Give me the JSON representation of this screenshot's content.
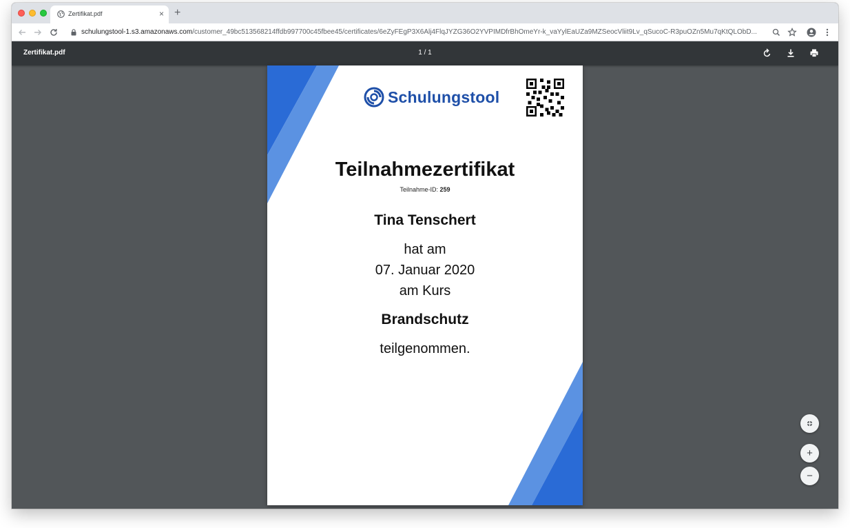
{
  "browser": {
    "tab_title": "Zertifikat.pdf",
    "tab_close": "×",
    "new_tab": "+",
    "url_host": "schulungstool-1.s3.amazonaws.com",
    "url_path": "/customer_49bc513568214ffdb997700c45fbee45/certificates/6eZyFEgP3X6Alj4FlqJYZG36O2YVPIMDfrBhOmeYr-k_vaYylEaUZa9MZSeocVliit9Lv_qSucoC-R3puOZn5Mu7qKtQLObD..."
  },
  "pdf_toolbar": {
    "title": "Zertifikat.pdf",
    "page_indicator": "1 / 1"
  },
  "certificate": {
    "logo_text": "Schulungstool",
    "title": "Teilnahmezertifikat",
    "id_label": "Teilnahme-ID:",
    "id_value": "259",
    "name": "Tina Tenschert",
    "line1": "hat am",
    "date": "07. Januar 2020",
    "line3": "am Kurs",
    "course": "Brandschutz",
    "ending": "teilgenommen."
  },
  "zoom": {
    "fit": "⤡",
    "plus": "+",
    "minus": "−"
  },
  "colors": {
    "accent_dark": "#2a6bd6",
    "accent_light": "#5b92e2",
    "pdf_bg": "#525659",
    "pdf_toolbar": "#323639"
  }
}
